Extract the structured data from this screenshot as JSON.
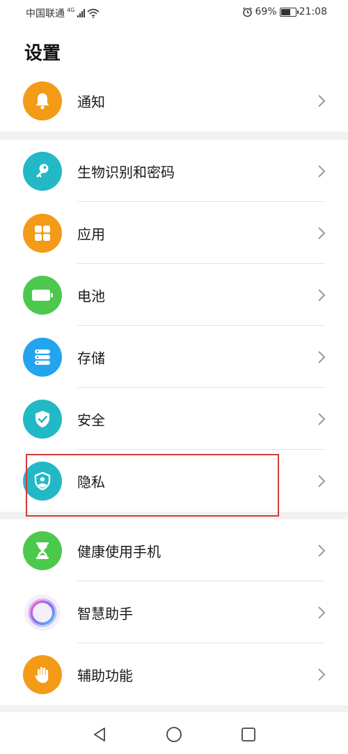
{
  "status_bar": {
    "carrier": "中国联通",
    "network": "4G",
    "battery_percent": "69%",
    "battery_level": 0.69,
    "time": "21:08"
  },
  "header": {
    "title": "设置"
  },
  "groups": [
    {
      "items": [
        {
          "label": "通知",
          "icon": "bell-icon",
          "color": "#f39a16"
        }
      ]
    },
    {
      "items": [
        {
          "label": "生物识别和密码",
          "icon": "key-icon",
          "color": "#22b8c6"
        },
        {
          "label": "应用",
          "icon": "apps-grid-icon",
          "color": "#f39a16"
        },
        {
          "label": "电池",
          "icon": "battery-icon",
          "color": "#4cc94c"
        },
        {
          "label": "存储",
          "icon": "storage-icon",
          "color": "#22a4ee"
        },
        {
          "label": "安全",
          "icon": "shield-check-icon",
          "color": "#22b8c6"
        },
        {
          "label": "隐私",
          "icon": "privacy-shield-icon",
          "color": "#22b8c6"
        }
      ]
    },
    {
      "items": [
        {
          "label": "健康使用手机",
          "icon": "hourglass-icon",
          "color": "#4cc94c"
        },
        {
          "label": "智慧助手",
          "icon": "assistant-ring-icon",
          "color": "#ffffff"
        },
        {
          "label": "辅助功能",
          "icon": "hand-icon",
          "color": "#f39a16"
        }
      ]
    }
  ],
  "highlighted_item": "隐私",
  "nav_bar": {
    "buttons": [
      "back-icon",
      "home-icon",
      "recents-icon"
    ]
  }
}
